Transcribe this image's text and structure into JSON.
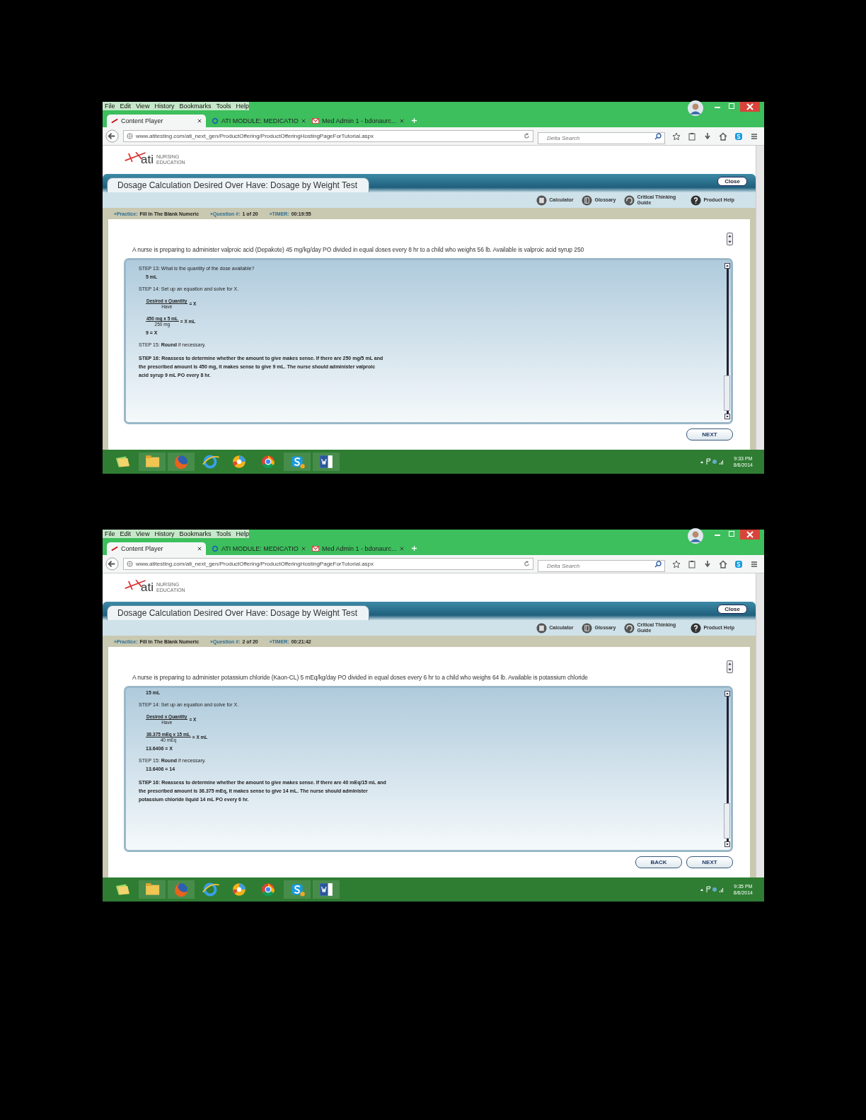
{
  "screens": [
    {
      "menu": [
        "File",
        "Edit",
        "View",
        "History",
        "Bookmarks",
        "Tools",
        "Help"
      ],
      "tabs": [
        {
          "label": "Content Player",
          "selected": true,
          "kind": "ati"
        },
        {
          "label": "ATI MODULE: MEDICATIO",
          "selected": false,
          "kind": "q"
        },
        {
          "label": "Med Admin 1 - bdonaurc...",
          "selected": false,
          "kind": "mail"
        }
      ],
      "url": "www.atitesting.com/ati_next_gen/ProductOffering/ProductOfferingHostingPageForTutorial.aspx",
      "search": {
        "placeholder": "Delta Search"
      },
      "logo": {
        "brand": "ati",
        "tagline": "NURSING EDUCATION"
      },
      "title": "Dosage Calculation Desired Over Have: Dosage by Weight Test",
      "close": "Close",
      "tools": [
        {
          "label": "Calculator",
          "kind": "calculator"
        },
        {
          "label": "Glossary",
          "kind": "glossary"
        },
        {
          "label": "Critical Thinking Guide",
          "kind": "guide"
        },
        {
          "label": "Product Help",
          "kind": "help"
        }
      ],
      "status": [
        {
          "label": "»Practice:",
          "value": "Fill In The Blank Numeric"
        },
        {
          "label": "»Question #:",
          "value": "1 of 20"
        },
        {
          "label": "»TIMER:",
          "value": "00:19:55"
        }
      ],
      "question": "A nurse is preparing to administer valproic acid (Depakote) 45 mg/kg/day PO divided in equal doses every 8 hr to a child who weighs 56 lb. Available is valproic acid syrup 250",
      "solution": [
        {
          "kind": "step",
          "text": "STEP 13: What is the quantity of the dose available?"
        },
        {
          "kind": "answer",
          "text": "5 mL"
        },
        {
          "kind": "step",
          "text": "STEP 14:  Set up an equation and solve for X."
        },
        {
          "kind": "fraction",
          "numerator": "Desired x Quantity",
          "denominator": "Have",
          "result": "= X"
        },
        {
          "kind": "fraction",
          "numerator": "450 mg x 5 mL",
          "denominator": "250 mg",
          "result": "= X mL"
        },
        {
          "kind": "answer",
          "text": "9 = X"
        },
        {
          "kind": "step",
          "text": "STEP 15: **Round** if necessary."
        },
        {
          "kind": "paragraph",
          "text": "STEP 16: Reassess to determine whether the amount to give makes sense. If there are 250 mg/5 mL and the prescribed amount is 450 mg, it makes sense to give 9 mL. The nurse should administer valproic acid syrup 9 mL PO every 8 hr."
        }
      ],
      "buttons": [
        "NEXT"
      ],
      "clock": {
        "time": "9:33 PM",
        "date": "8/6/2014"
      }
    },
    {
      "menu": [
        "File",
        "Edit",
        "View",
        "History",
        "Bookmarks",
        "Tools",
        "Help"
      ],
      "tabs": [
        {
          "label": "Content Player",
          "selected": true,
          "kind": "ati"
        },
        {
          "label": "ATI MODULE: MEDICATIO",
          "selected": false,
          "kind": "q"
        },
        {
          "label": "Med Admin 1 - bdonaurc...",
          "selected": false,
          "kind": "mail"
        }
      ],
      "url": "www.atitesting.com/ati_next_gen/ProductOffering/ProductOfferingHostingPageForTutorial.aspx",
      "search": {
        "placeholder": "Delta Search"
      },
      "logo": {
        "brand": "ati",
        "tagline": "NURSING EDUCATION"
      },
      "title": "Dosage Calculation Desired Over Have: Dosage by Weight Test",
      "close": "Close",
      "tools": [
        {
          "label": "Calculator",
          "kind": "calculator"
        },
        {
          "label": "Glossary",
          "kind": "glossary"
        },
        {
          "label": "Critical Thinking Guide",
          "kind": "guide"
        },
        {
          "label": "Product Help",
          "kind": "help"
        }
      ],
      "status": [
        {
          "label": "»Practice:",
          "value": "Fill In The Blank Numeric"
        },
        {
          "label": "»Question #:",
          "value": "2 of 20"
        },
        {
          "label": "»TIMER:",
          "value": "00:21:42"
        }
      ],
      "question": "A nurse is preparing to administer potassium chloride (Kaon-CL) 5 mEq/kg/day PO divided in equal doses every 6 hr to a child who weighs 64 lb. Available is potassium chloride",
      "solution": [
        {
          "kind": "answer",
          "text": "15 mL"
        },
        {
          "kind": "step",
          "text": "STEP 14:  Set up an equation and solve for X."
        },
        {
          "kind": "fraction",
          "numerator": "Desired x Quantity",
          "denominator": "Have",
          "result": "= X"
        },
        {
          "kind": "fraction",
          "numerator": "36.375 mEq x 15 mL",
          "denominator": "40 mEq",
          "result": "= X mL"
        },
        {
          "kind": "answer",
          "text": "13.6406 = X"
        },
        {
          "kind": "step",
          "text": "STEP 15: **Round** if necessary."
        },
        {
          "kind": "answer",
          "text": "13.6406 = 14"
        },
        {
          "kind": "paragraph",
          "text": "STEP 16: Reassess to determine whether the amount to give makes sense. If there are 40 mEq/15 mL and the prescribed amount is 36.375 mEq, it makes sense to give 14 mL. The nurse should administer potassium chloride liquid 14 mL PO every 6 hr."
        }
      ],
      "buttons": [
        "BACK",
        "NEXT"
      ],
      "clock": {
        "time": "9:35 PM",
        "date": "8/6/2014"
      }
    }
  ]
}
